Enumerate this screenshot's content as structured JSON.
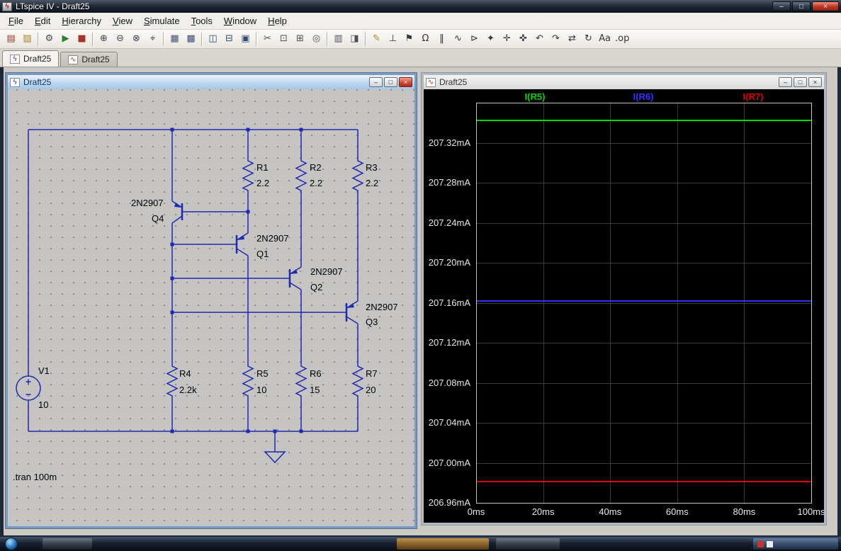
{
  "window": {
    "title": "LTspice IV - Draft25"
  },
  "menu": {
    "items": [
      "File",
      "Edit",
      "Hierarchy",
      "View",
      "Simulate",
      "Tools",
      "Window",
      "Help"
    ]
  },
  "toolbar": {
    "buttons": [
      {
        "name": "new-schematic-button",
        "glyph": "▤",
        "color": "#9c3328"
      },
      {
        "name": "open-file-button",
        "glyph": "▨",
        "color": "#a8842c"
      },
      {
        "separator": true
      },
      {
        "name": "control-panel-button",
        "glyph": "⚙",
        "color": "#4a4f56"
      },
      {
        "name": "run-button",
        "glyph": "▶",
        "color": "#2d7d33"
      },
      {
        "name": "halt-button",
        "glyph": "■",
        "color": "#a83226"
      },
      {
        "separator": true
      },
      {
        "name": "zoom-in-button",
        "glyph": "⊕",
        "color": "#3c4250"
      },
      {
        "name": "zoom-back-button",
        "glyph": "⊖",
        "color": "#3c4250"
      },
      {
        "name": "zoom-full-extents-button",
        "glyph": "⊗",
        "color": "#3c4250"
      },
      {
        "name": "pan-button",
        "glyph": "⌖",
        "color": "#3c4250"
      },
      {
        "separator": true
      },
      {
        "name": "grid-button",
        "glyph": "▦",
        "color": "#41507a"
      },
      {
        "name": "mark-unconnected-button",
        "glyph": "▩",
        "color": "#41507a"
      },
      {
        "separator": true
      },
      {
        "name": "tile-horizontal-button",
        "glyph": "◫",
        "color": "#2f4a6e"
      },
      {
        "name": "tile-vertical-button",
        "glyph": "⊟",
        "color": "#2f4a6e"
      },
      {
        "name": "cascade-windows-button",
        "glyph": "▣",
        "color": "#2f4a6e"
      },
      {
        "separator": true
      },
      {
        "name": "cut-button",
        "glyph": "✂",
        "color": "#4a4f56"
      },
      {
        "name": "copy-button",
        "glyph": "⊡",
        "color": "#4a4f56"
      },
      {
        "name": "paste-button",
        "glyph": "⊞",
        "color": "#4a4f56"
      },
      {
        "name": "find-button",
        "glyph": "◎",
        "color": "#4a4f56"
      },
      {
        "separator": true
      },
      {
        "name": "print-button",
        "glyph": "▥",
        "color": "#4a4f56"
      },
      {
        "name": "print-preview-button",
        "glyph": "◨",
        "color": "#4a4f56"
      },
      {
        "separator": true
      },
      {
        "name": "draft-wire-button",
        "glyph": "✎",
        "color": "#a8842c"
      },
      {
        "name": "ground-button",
        "glyph": "⊥",
        "color": "#33383f"
      },
      {
        "name": "net-label-button",
        "glyph": "⚑",
        "color": "#33383f"
      },
      {
        "name": "resistor-button",
        "glyph": "Ω",
        "color": "#33383f"
      },
      {
        "name": "capacitor-button",
        "glyph": "‖",
        "color": "#33383f"
      },
      {
        "name": "inductor-button",
        "glyph": "∿",
        "color": "#33383f"
      },
      {
        "name": "diode-button",
        "glyph": "⊳",
        "color": "#33383f"
      },
      {
        "name": "component-button",
        "glyph": "✦",
        "color": "#33383f"
      },
      {
        "name": "move-button",
        "glyph": "✛",
        "color": "#33383f"
      },
      {
        "name": "drag-button",
        "glyph": "✜",
        "color": "#33383f"
      },
      {
        "name": "undo-button",
        "glyph": "↶",
        "color": "#33383f"
      },
      {
        "name": "redo-button",
        "glyph": "↷",
        "color": "#33383f"
      },
      {
        "name": "mirror-button",
        "glyph": "⇄",
        "color": "#33383f"
      },
      {
        "name": "rotate-button",
        "glyph": "↻",
        "color": "#33383f"
      },
      {
        "name": "text-button",
        "glyph": "Aa",
        "color": "#33383f"
      },
      {
        "name": "spice-directive-button",
        "glyph": ".op",
        "color": "#33383f"
      }
    ]
  },
  "tabs": [
    {
      "label": "Draft25",
      "icon": "schematic-icon",
      "active": true
    },
    {
      "label": "Draft25",
      "icon": "waveform-icon",
      "active": false
    }
  ],
  "schematic_window": {
    "title": "Draft25",
    "directive": ".tran 100m",
    "components": {
      "r1": {
        "ref": "R1",
        "value": "2.2"
      },
      "r2": {
        "ref": "R2",
        "value": "2.2"
      },
      "r3": {
        "ref": "R3",
        "value": "2.2"
      },
      "r4": {
        "ref": "R4",
        "value": "2.2k"
      },
      "r5": {
        "ref": "R5",
        "value": "10"
      },
      "r6": {
        "ref": "R6",
        "value": "15"
      },
      "r7": {
        "ref": "R7",
        "value": "20"
      },
      "q1": {
        "ref": "Q1",
        "type": "2N2907"
      },
      "q2": {
        "ref": "Q2",
        "type": "2N2907"
      },
      "q3": {
        "ref": "Q3",
        "type": "2N2907"
      },
      "q4": {
        "ref": "Q4",
        "type": "2N2907"
      },
      "v1": {
        "ref": "V1",
        "value": "10"
      }
    }
  },
  "waveform_window": {
    "title": "Draft25",
    "y_labels": [
      "207.32mA",
      "207.28mA",
      "207.24mA",
      "207.20mA",
      "207.16mA",
      "207.12mA",
      "207.08mA",
      "207.04mA",
      "207.00mA",
      "206.96mA"
    ],
    "x_labels": [
      "0ms",
      "20ms",
      "40ms",
      "60ms",
      "80ms",
      "100ms"
    ]
  },
  "chart_data": {
    "type": "line",
    "title": "",
    "xlabel": "",
    "ylabel": "",
    "xlim": [
      0,
      100
    ],
    "ylim": [
      206.96,
      207.36
    ],
    "x_ticks": [
      0,
      20,
      40,
      60,
      80,
      100
    ],
    "grid": true,
    "legend_position": "top",
    "background": "#000000",
    "x": [
      0,
      100
    ],
    "series": [
      {
        "name": "I(R5)",
        "color": "#00d800",
        "values": [
          207.342,
          207.342
        ]
      },
      {
        "name": "I(R6)",
        "color": "#3134ff",
        "values": [
          207.162,
          207.162
        ]
      },
      {
        "name": "I(R7)",
        "color": "#e00000",
        "values": [
          206.981,
          206.981
        ]
      }
    ]
  }
}
